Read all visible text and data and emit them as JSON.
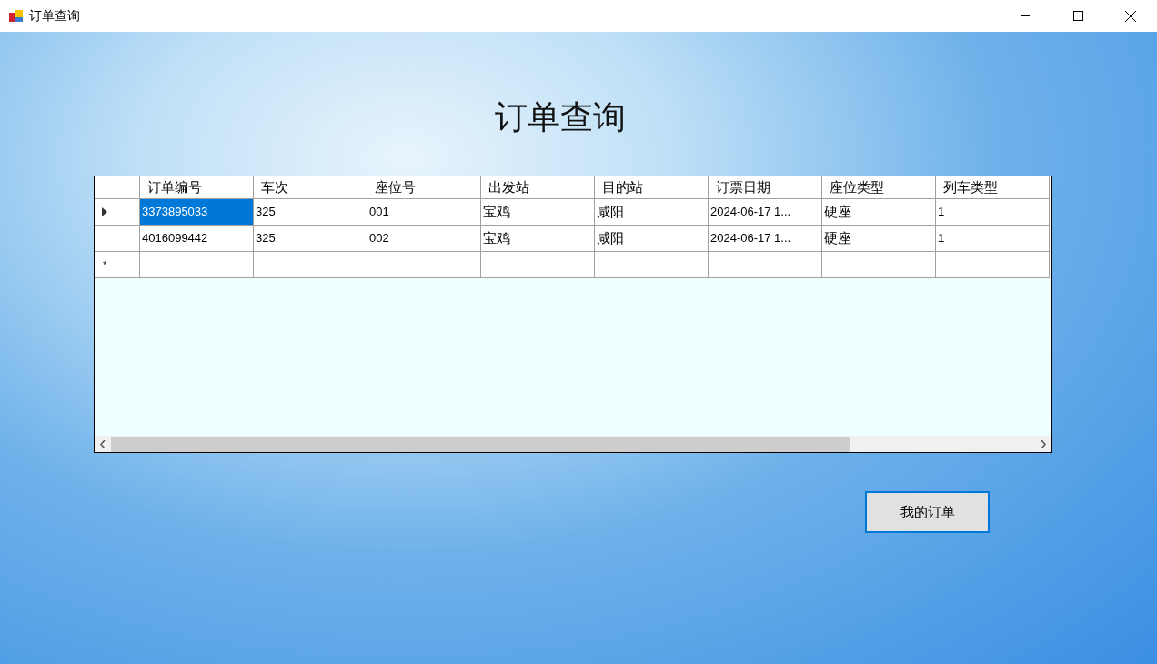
{
  "window": {
    "title": "订单查询"
  },
  "heading": "订单查询",
  "table": {
    "columns": [
      "订单编号",
      "车次",
      "座位号",
      "出发站",
      "目的站",
      "订票日期",
      "座位类型",
      "列车类型"
    ],
    "rows": [
      {
        "selected": true,
        "cells": [
          "3373895033",
          "325",
          "001",
          "宝鸡",
          "咸阳",
          "2024-06-17 1...",
          "硬座",
          "1"
        ]
      },
      {
        "selected": false,
        "cells": [
          "4016099442",
          "325",
          "002",
          "宝鸡",
          "咸阳",
          "2024-06-17 1...",
          "硬座",
          "1"
        ]
      }
    ],
    "new_row_marker": "*"
  },
  "buttons": [
    "我的订单"
  ]
}
